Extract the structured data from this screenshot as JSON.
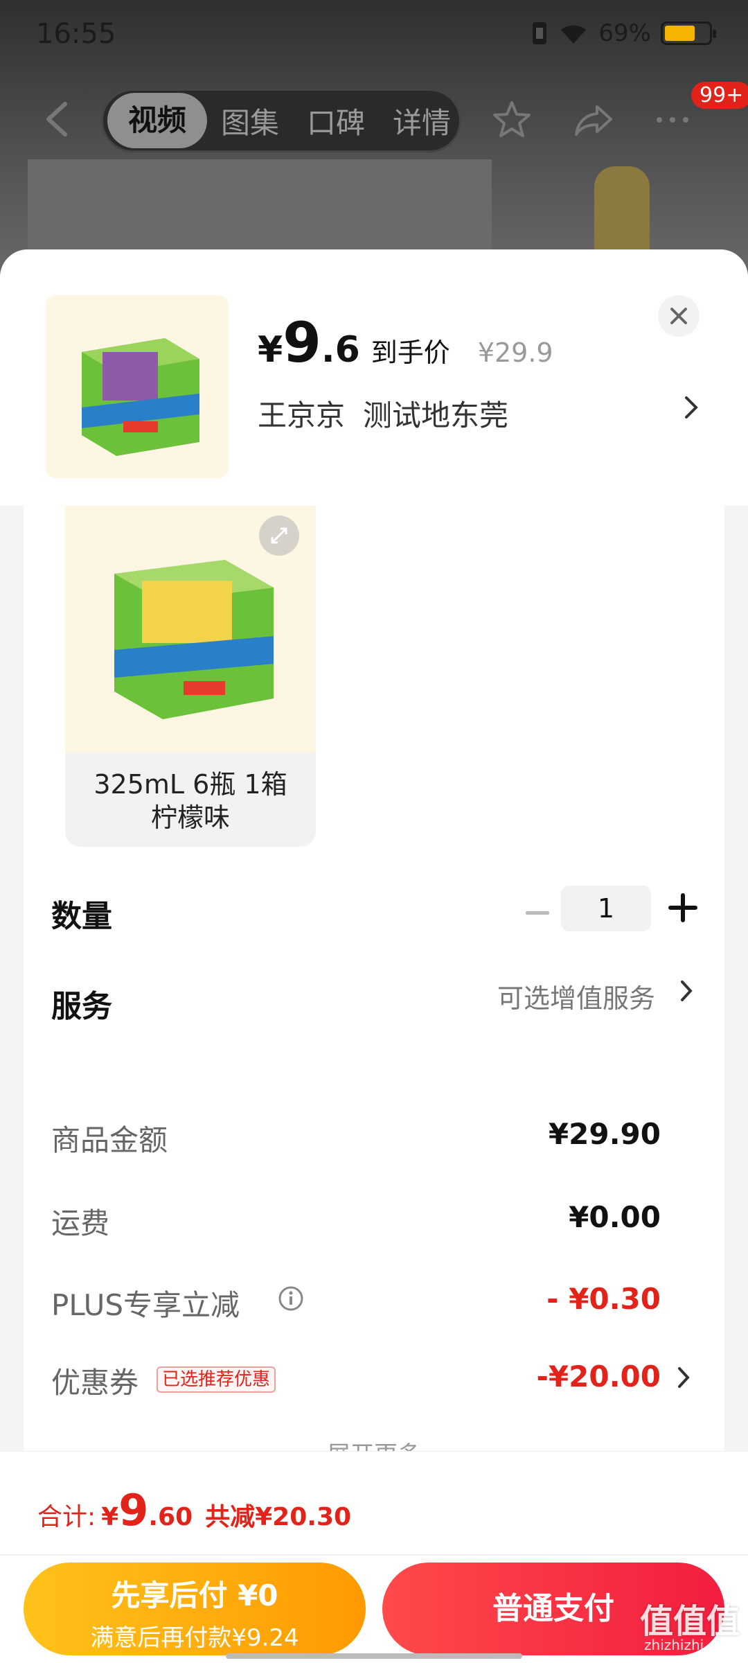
{
  "status_bar": {
    "time": "16:55",
    "battery": "69%",
    "battery_level": 0.69
  },
  "nav": {
    "tabs": [
      {
        "label": "视频",
        "active": true
      },
      {
        "label": "图集",
        "active": false
      },
      {
        "label": "口碑",
        "active": false
      },
      {
        "label": "详情",
        "active": false
      }
    ],
    "badge": "99+"
  },
  "sheet": {
    "price": {
      "yen": "¥",
      "integer": "9",
      "decimal": ".6",
      "label": "到手价",
      "original": "¥29.9"
    },
    "address": {
      "name": "王京京",
      "location": "测试地东莞"
    },
    "variant": {
      "line1": "325mL 6瓶 1箱",
      "line2": "柠檬味"
    },
    "quantity": {
      "label": "数量",
      "value": "1"
    },
    "service": {
      "label": "服务",
      "value": "可选增值服务"
    },
    "fees": [
      {
        "label": "商品金额",
        "value": "¥29.90",
        "red": false
      },
      {
        "label": "运费",
        "value": "¥0.00",
        "red": false
      },
      {
        "label": "PLUS专享立减",
        "value": "- ¥0.30",
        "red": true
      },
      {
        "label": "优惠券",
        "value": "-¥20.00",
        "red": true,
        "tag": "已选推荐优惠"
      }
    ],
    "more": "展开更多"
  },
  "bottom": {
    "total": {
      "label": "合计:",
      "yen": "¥",
      "integer": "9",
      "decimal": ".60",
      "saved": "共减¥20.30"
    },
    "pay_later": {
      "line1": "先享后付 ¥0",
      "line2": "满意后再付款¥9.24"
    },
    "pay_now": "普通支付"
  },
  "watermark": {
    "main": "值值值",
    "sub": "zhizhizhi.com"
  },
  "colors": {
    "price_red": "#e2231a",
    "pay_later_orange": "#ffb000",
    "pay_red": "#f5334a"
  }
}
